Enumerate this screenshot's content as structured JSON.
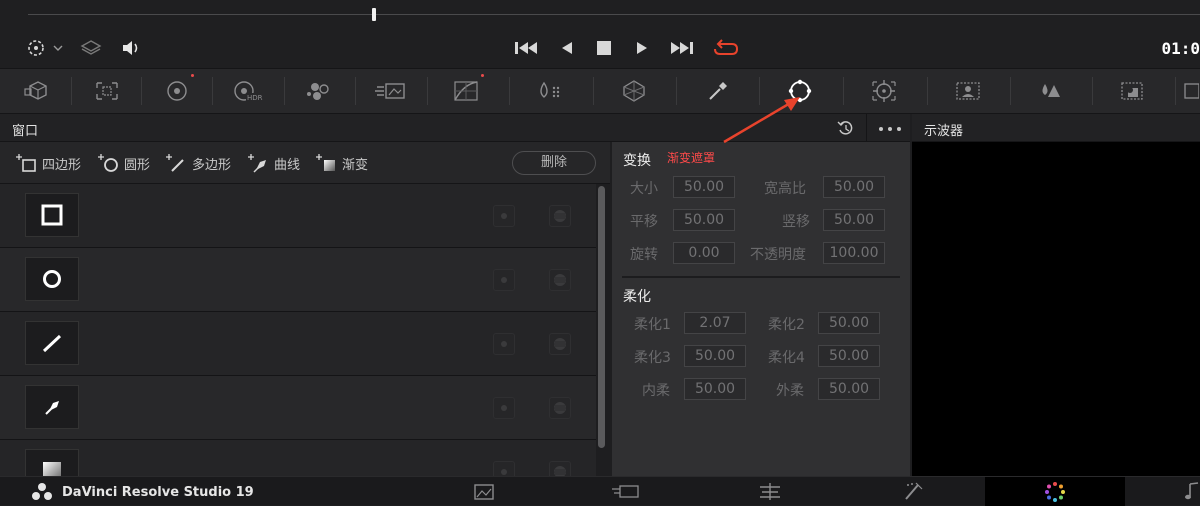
{
  "transport": {
    "timecode": "01:0"
  },
  "panels": {
    "window_title": "窗口",
    "scope_title": "示波器"
  },
  "shape_tools": [
    {
      "label": "四边形",
      "icon": "add-rectangle-icon"
    },
    {
      "label": "圆形",
      "icon": "add-circle-icon"
    },
    {
      "label": "多边形",
      "icon": "add-polygon-icon"
    },
    {
      "label": "曲线",
      "icon": "add-curve-icon"
    },
    {
      "label": "渐变",
      "icon": "add-gradient-icon"
    }
  ],
  "delete_label": "删除",
  "window_rows": [
    {
      "shape": "rectangle-window-icon"
    },
    {
      "shape": "circle-window-icon"
    },
    {
      "shape": "polygon-window-icon"
    },
    {
      "shape": "curve-window-icon"
    },
    {
      "shape": "gradient-window-icon"
    }
  ],
  "inspector": {
    "transform": {
      "title": "变换",
      "annotation": "渐变遮罩",
      "size_label": "大小",
      "size": "50.00",
      "aspect_label": "宽高比",
      "aspect": "50.00",
      "pan_label": "平移",
      "pan": "50.00",
      "tilt_label": "竖移",
      "tilt": "50.00",
      "rotate_label": "旋转",
      "rotate": "0.00",
      "opacity_label": "不透明度",
      "opacity": "100.00"
    },
    "softness": {
      "title": "柔化",
      "soft1_label": "柔化1",
      "soft1": "2.07",
      "soft2_label": "柔化2",
      "soft2": "50.00",
      "soft3_label": "柔化3",
      "soft3": "50.00",
      "soft4_label": "柔化4",
      "soft4": "50.00",
      "inside_label": "内柔",
      "inside": "50.00",
      "outside_label": "外柔",
      "outside": "50.00"
    }
  },
  "brand": {
    "name": "DaVinci Resolve Studio 19"
  },
  "colors": {
    "accent_red": "#e84b4b",
    "loop_red": "#e8432c"
  }
}
